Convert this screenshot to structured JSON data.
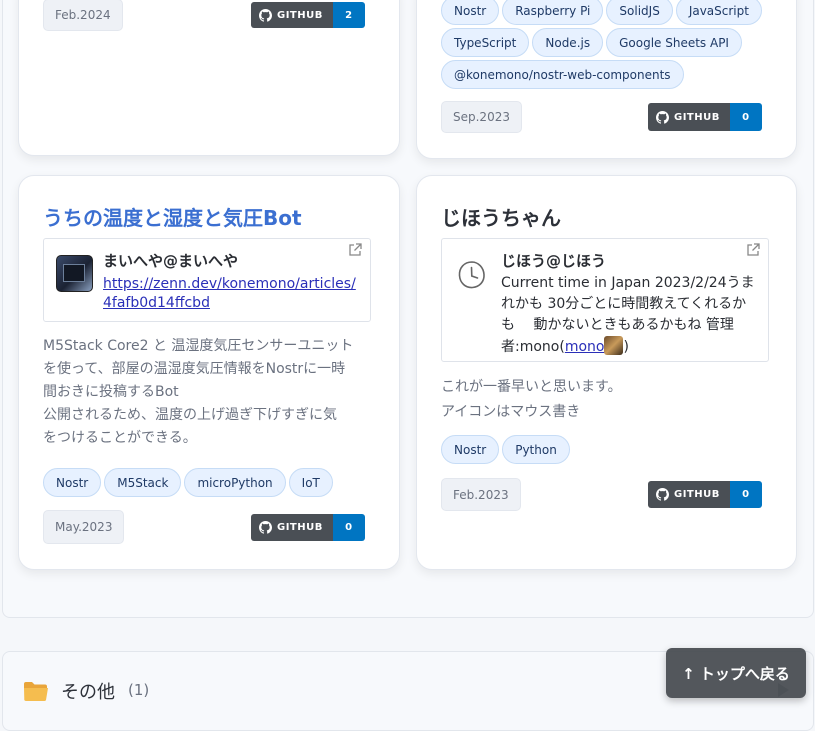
{
  "cards": {
    "top_left": {
      "date": "Feb.2024",
      "github_label": "GITHUB",
      "github_count": "2"
    },
    "top_right": {
      "tags": [
        "Nostr",
        "Raspberry Pi",
        "SolidJS",
        "JavaScript",
        "TypeScript",
        "Node.js",
        "Google Sheets API",
        "@konemono/nostr-web-components"
      ],
      "date": "Sep.2023",
      "github_label": "GITHUB",
      "github_count": "0"
    },
    "bottom_left": {
      "title": "うちの温度と湿度と気圧Bot",
      "embed_name": "まいへや@まいへや",
      "embed_link_line1": "https://zenn.dev/konemono/articles/",
      "embed_link_line2": "4fafb0d14ffcbd",
      "desc_lines": [
        "M5Stack Core2 と 温湿度気圧センサーユニット",
        "を使って、部屋の温湿度気圧情報をNostrに一時",
        "間おきに投稿するBot",
        "公開されるため、温度の上げ過ぎ下げすぎに気",
        "をつけることができる。"
      ],
      "tags": [
        "Nostr",
        "M5Stack",
        "microPython",
        "IoT"
      ],
      "date": "May.2023",
      "github_label": "GITHUB",
      "github_count": "0"
    },
    "bottom_right": {
      "title": "じほうちゃん",
      "embed_name": "じほう@じほう",
      "embed_line1": "Current time in Japan 2023/2/24うま",
      "embed_line2": "れかも 30分ごとに時間教えてくれるか",
      "embed_line3": "も　 動かないときもあるかもね 管理",
      "embed_line4_prefix": "者:mono(",
      "embed_line4_link": "mono",
      "embed_line4_suffix": ")",
      "desc_lines": [
        "これが一番早いと思います。",
        "アイコンはマウス書き"
      ],
      "tags": [
        "Nostr",
        "Python"
      ],
      "date": "Feb.2023",
      "github_label": "GITHUB",
      "github_count": "0"
    }
  },
  "other_section": {
    "label": "その他",
    "count": "(1)"
  },
  "back_to_top": "↑ トップへ戻る",
  "colors": {
    "accent": "#0075c2",
    "title_link": "#3b6fd1",
    "github_dark": "#4a4f55"
  }
}
